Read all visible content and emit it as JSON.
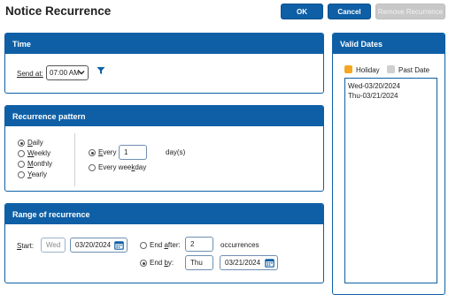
{
  "title": "Notice Recurrence",
  "buttons": {
    "ok": "OK",
    "cancel": "Cancel",
    "remove": "Remove Recurrence"
  },
  "time": {
    "header": "Time",
    "send_at_label": "Send at:",
    "send_at_value": "07:00 AM",
    "filter_icon": "filter-icon"
  },
  "pattern": {
    "header": "Recurrence pattern",
    "options": [
      "Daily",
      "Weekly",
      "Monthly",
      "Yearly"
    ],
    "selected": "Daily",
    "every_label": "Every",
    "every_value": "1",
    "every_unit": "day(s)",
    "every_weekday_label": "Every weekday"
  },
  "range": {
    "header": "Range of recurrence",
    "start_label": "Start:",
    "start_day": "Wed",
    "start_date": "03/20/2024",
    "end_after_label": "End after:",
    "end_after_value": "2",
    "occurrences_label": "occurrences",
    "end_by_label": "End by:",
    "end_by_day": "Thu",
    "end_by_date": "03/21/2024",
    "selected": "End by"
  },
  "valid_dates": {
    "header": "Valid Dates",
    "legend_holiday": "Holiday",
    "legend_past": "Past Date",
    "holiday_color": "#f5a623",
    "past_color": "#cfcfcf",
    "dates": [
      "Wed-03/20/2024",
      "Thu-03/21/2024"
    ]
  },
  "colors": {
    "accent": "#0e5fa6"
  }
}
